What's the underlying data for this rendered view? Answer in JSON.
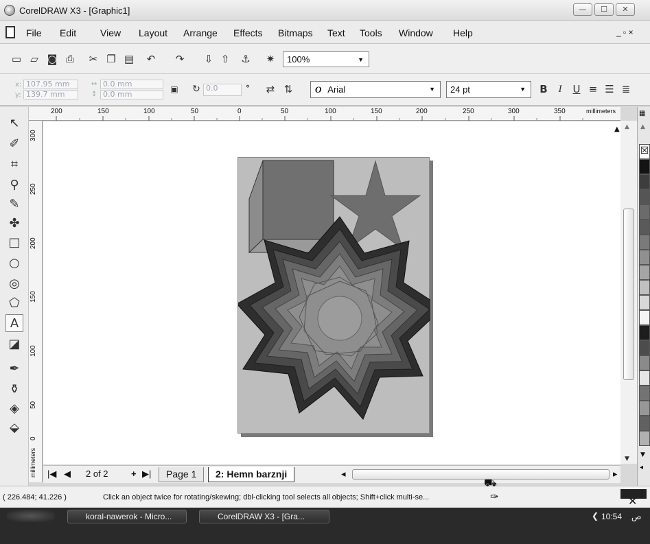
{
  "window": {
    "title": "CorelDRAW X3 - [Graphic1]",
    "minimize_label": "—",
    "maximize_label": "☐",
    "close_label": "✕"
  },
  "menubar": {
    "items": [
      {
        "label": "File"
      },
      {
        "label": "Edit"
      },
      {
        "label": "View"
      },
      {
        "label": "Layout"
      },
      {
        "label": "Arrange"
      },
      {
        "label": "Effects"
      },
      {
        "label": "Bitmaps"
      },
      {
        "label": "Text"
      },
      {
        "label": "Tools"
      },
      {
        "label": "Window"
      },
      {
        "label": "Help"
      }
    ],
    "doc_controls": "_ ▫ ×"
  },
  "toolbar": {
    "zoom_value": "100%",
    "icons": [
      "new-icon",
      "open-icon",
      "save-icon",
      "print-icon",
      "cut-icon",
      "copy-icon",
      "paste-icon",
      "undo-icon",
      "redo-icon",
      "import-icon",
      "export-icon",
      "app-launcher-icon",
      "welcome-icon"
    ]
  },
  "property_bar": {
    "x_label": "x:",
    "x_value": "107.95 mm",
    "y_label": "y:",
    "y_value": "139.7 mm",
    "w_value": "0.0 mm",
    "h_value": "0.0 mm",
    "angle_value": "0.0",
    "degree_symbol": "°",
    "font_name": "Arial",
    "font_size": "24 pt",
    "bold_label": "B",
    "italic_label": "I",
    "underline_label": "U"
  },
  "ruler": {
    "h_ticks": [
      "200",
      "150",
      "100",
      "50",
      "0",
      "50",
      "100",
      "150",
      "200",
      "250",
      "300",
      "350"
    ],
    "h_unit": "millimeters",
    "v_ticks": [
      "300",
      "250",
      "200",
      "150",
      "100",
      "50",
      "0"
    ],
    "v_unit": "millimeters"
  },
  "page_nav": {
    "first_label": "|◀",
    "prev_label": "◀",
    "count": "2 of 2",
    "add_label": "+",
    "next_label": "▶|",
    "tabs": [
      {
        "label": "Page 1"
      },
      {
        "label": "2: Hemn barznji"
      }
    ]
  },
  "status": {
    "coords": "( 226.484; 41.226 )",
    "hint": "Click an object twice for rotating/skewing; dbl-clicking tool selects all objects; Shift+click multi-se..."
  },
  "taskbar": {
    "tasks": [
      {
        "label": "koral-nawerok - Micro..."
      },
      {
        "label": "CorelDRAW X3 - [Gra..."
      }
    ],
    "clock": "10:54",
    "clock_suffix": "ص"
  },
  "colors": {
    "cube": "#707070",
    "star": "#6e6e6e",
    "page": "#bdbdbd"
  }
}
